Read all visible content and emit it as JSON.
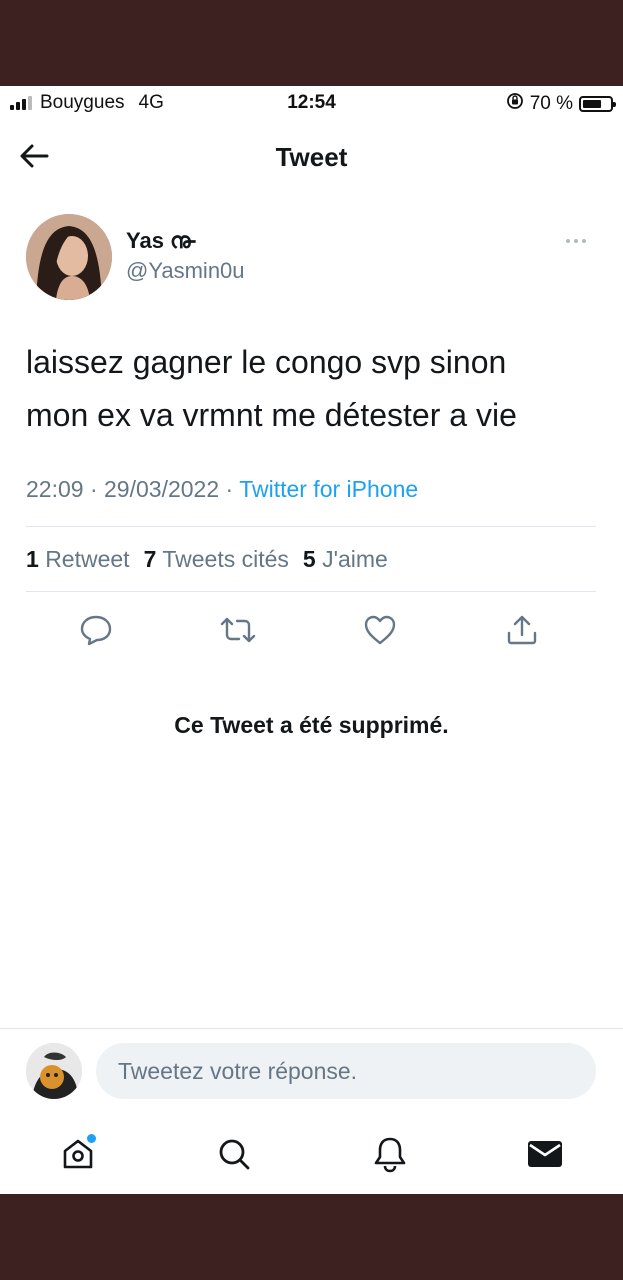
{
  "status_bar": {
    "carrier": "Bouygues",
    "network": "4G",
    "time": "12:54",
    "battery_label": "70 %",
    "battery_level": 0.7
  },
  "nav": {
    "title": "Tweet",
    "back_icon": "arrow-left-icon"
  },
  "tweet": {
    "author_name": "Yas ൹",
    "author_handle": "@Yasmin0u",
    "text_line1": "laissez gagner le congo svp sinon",
    "text_line2": "mon ex va vrmnt me détester a vie",
    "time": "22:09",
    "date": "29/03/2022",
    "separator": "·",
    "source": "Twitter for iPhone",
    "stats": {
      "retweets_count": "1",
      "retweets_label": "Retweet",
      "quotes_count": "7",
      "quotes_label": "Tweets cités",
      "likes_count": "5",
      "likes_label": "J'aime"
    },
    "actions": [
      "reply-icon",
      "retweet-icon",
      "like-icon",
      "share-icon"
    ]
  },
  "deleted_notice": "Ce Tweet a été supprimé.",
  "reply": {
    "placeholder": "Tweetez votre réponse."
  },
  "tabbar": {
    "items": [
      "home-icon",
      "search-icon",
      "notifications-icon",
      "messages-icon"
    ],
    "home_has_dot": true
  },
  "colors": {
    "accent": "#1da1f2",
    "text": "#14171a",
    "secondary": "#657786",
    "frame": "#3d2120"
  }
}
